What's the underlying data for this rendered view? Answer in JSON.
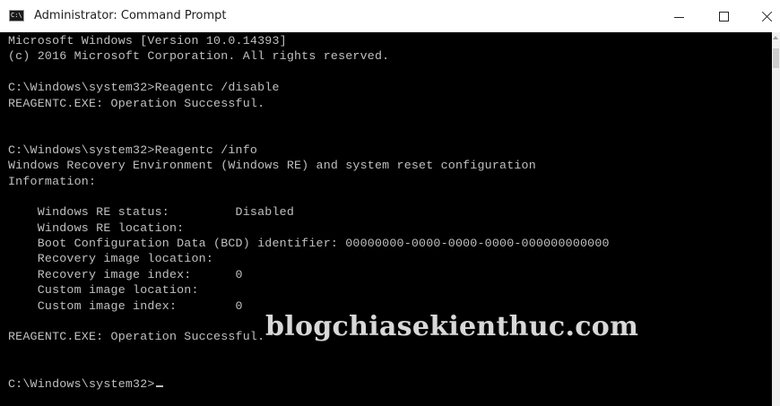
{
  "window": {
    "title": "Administrator: Command Prompt",
    "icon": "cmd-icon",
    "icon_text": "C:\\",
    "controls": {
      "minimize_icon": "minimize-icon",
      "maximize_icon": "maximize-icon",
      "close_icon": "close-icon"
    }
  },
  "console": {
    "background": "#000000",
    "foreground": "#c0c0c0",
    "lines": [
      "Microsoft Windows [Version 10.0.14393]",
      "(c) 2016 Microsoft Corporation. All rights reserved.",
      "",
      "C:\\Windows\\system32>Reagentc /disable",
      "REAGENTC.EXE: Operation Successful.",
      "",
      "",
      "C:\\Windows\\system32>Reagentc /info",
      "Windows Recovery Environment (Windows RE) and system reset configuration",
      "Information:",
      "",
      "    Windows RE status:         Disabled",
      "    Windows RE location:",
      "    Boot Configuration Data (BCD) identifier: 00000000-0000-0000-0000-000000000000",
      "    Recovery image location:",
      "    Recovery image index:      0",
      "    Custom image location:",
      "    Custom image index:        0",
      "",
      "REAGENTC.EXE: Operation Successful.",
      "",
      "",
      "C:\\Windows\\system32>"
    ],
    "prompt_line_index": 22
  },
  "watermark": {
    "text": "blogchiasekienthuc.com"
  }
}
